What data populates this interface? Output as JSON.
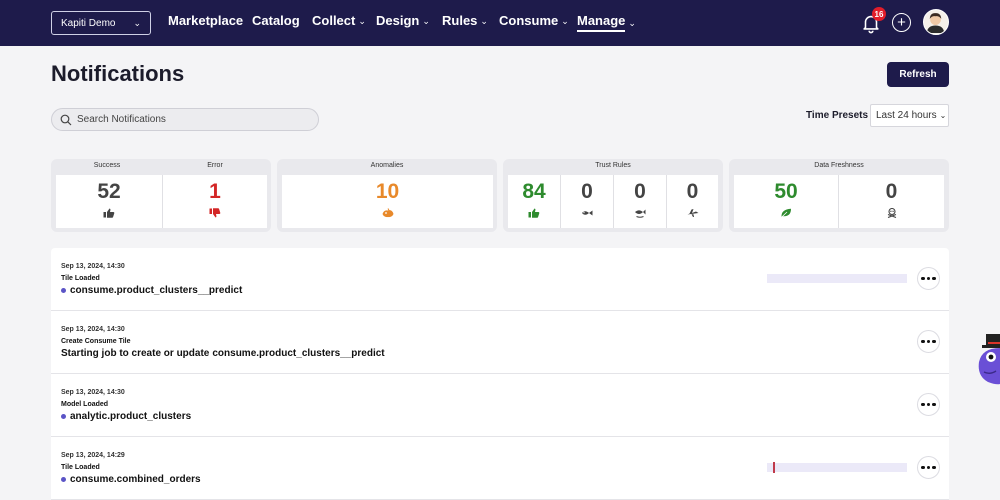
{
  "nav": {
    "workspace": "Kapiti Demo",
    "items": [
      {
        "label": "Marketplace",
        "dropdown": false,
        "active": false
      },
      {
        "label": "Catalog",
        "dropdown": false,
        "active": false
      },
      {
        "label": "Collect",
        "dropdown": true,
        "active": false
      },
      {
        "label": "Design",
        "dropdown": true,
        "active": false
      },
      {
        "label": "Rules",
        "dropdown": true,
        "active": false
      },
      {
        "label": "Consume",
        "dropdown": true,
        "active": false
      },
      {
        "label": "Manage",
        "dropdown": true,
        "active": true
      }
    ],
    "notification_count": "16",
    "icons": [
      "bell-icon",
      "plus-circle-icon",
      "avatar"
    ]
  },
  "page": {
    "title": "Notifications",
    "refresh_label": "Refresh",
    "search_placeholder": "Search Notifications",
    "time_presets_label": "Time Presets",
    "time_preset_value": "Last 24 hours"
  },
  "stats": {
    "success": {
      "label": "Success",
      "value": "52",
      "icon": "thumbs-up-icon"
    },
    "error": {
      "label": "Error",
      "value": "1",
      "icon": "thumbs-down-icon"
    },
    "anomalies": {
      "label": "Anomalies",
      "value": "10",
      "icon": "anomaly-icon"
    },
    "trust_rules": {
      "label": "Trust Rules",
      "tiles": [
        {
          "value": "84",
          "icon": "thumbs-up-icon"
        },
        {
          "value": "0",
          "icon": "fish-icon"
        },
        {
          "value": "0",
          "icon": "fish-dead-icon"
        },
        {
          "value": "0",
          "icon": "plane-icon"
        }
      ]
    },
    "data_freshness": {
      "label": "Data Freshness",
      "tiles": [
        {
          "value": "50",
          "icon": "leaf-icon"
        },
        {
          "value": "0",
          "icon": "skull-icon"
        }
      ]
    },
    "colors": {
      "success": "#2e8b2e",
      "error": "#d32626",
      "anomaly": "#e8892a",
      "neutral": "#444444"
    }
  },
  "notifications": [
    {
      "timestamp": "Sep 13, 2024, 14:30",
      "type": "Tile Loaded",
      "prefix": "",
      "object": "consume.product_clusters__predict",
      "dot": true,
      "spark": true,
      "spark_tick": false
    },
    {
      "timestamp": "Sep 13, 2024, 14:30",
      "type": "Create Consume Tile",
      "prefix": "Starting job to create or update",
      "object": "consume.product_clusters__predict",
      "dot": false,
      "spark": false,
      "spark_tick": false
    },
    {
      "timestamp": "Sep 13, 2024, 14:30",
      "type": "Model Loaded",
      "prefix": "",
      "object": "analytic.product_clusters",
      "dot": true,
      "spark": false,
      "spark_tick": false
    },
    {
      "timestamp": "Sep 13, 2024, 14:29",
      "type": "Tile Loaded",
      "prefix": "",
      "object": "consume.combined_orders",
      "dot": true,
      "spark": true,
      "spark_tick": true
    }
  ]
}
